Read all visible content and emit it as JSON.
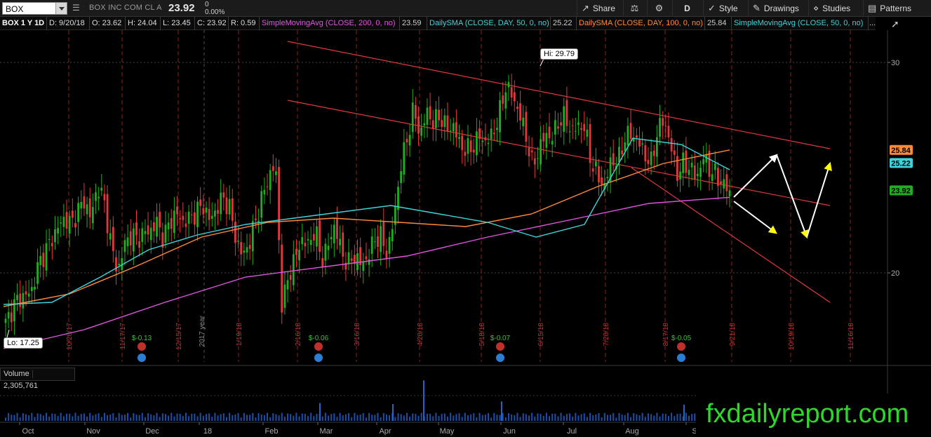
{
  "toolbar": {
    "symbol": "BOX",
    "company": "BOX INC COM CL A",
    "last": "23.92",
    "change": "0",
    "change_pct": "0.00%",
    "share": "Share",
    "aggregation": "D",
    "style": "Style",
    "drawings": "Drawings",
    "studies": "Studies",
    "patterns": "Patterns"
  },
  "infobar": {
    "title": "BOX 1 Y 1D",
    "date": "D: 9/20/18",
    "open": "O: 23.62",
    "high": "H: 24.04",
    "low": "L: 23.45",
    "close": "C: 23.92",
    "range": "R: 0.59",
    "sma200_label": "SimpleMovingAvg (CLOSE, 200, 0, no)",
    "sma200_val": "23.59",
    "sma50_label": "DailySMA (CLOSE, DAY, 50, 0, no)",
    "sma50_val": "25.22",
    "sma100_label": "DailySMA (CLOSE, DAY, 100, 0, no)",
    "sma100_val": "25.84",
    "sma50b_label": "SimpleMovingAvg (CLOSE, 50, 0, no)",
    "ellipsis": "..."
  },
  "volume": {
    "label": "Volume",
    "value": "2,305,761"
  },
  "watermark": "fxdailyreport.com",
  "colors": {
    "up": "#1fae1f",
    "down": "#e0393d",
    "sma50": "#3fd4dc",
    "sma100": "#ff8a3a",
    "sma200": "#e055e0",
    "channel": "#e0393d",
    "arrows": "#ffffff"
  },
  "chart_data": {
    "type": "candlestick",
    "ylim": [
      15.5,
      32.6
    ],
    "y_ticks": [
      20,
      30
    ],
    "y_tick_labels": [
      "20",
      "30"
    ],
    "months": [
      "Oct",
      "Nov",
      "Dec",
      "18",
      "Feb",
      "Mar",
      "Apr",
      "May",
      "Jun",
      "Jul",
      "Aug",
      "S"
    ],
    "expiration_dates": [
      "10/20/17",
      "11/17/17",
      "12/15/17",
      "1/19/18",
      "2/16/18",
      "3/16/18",
      "4/20/18",
      "5/18/18",
      "6/15/18",
      "7/20/18",
      "8/17/18",
      "9/21/18",
      "10/19/18",
      "11/16/18"
    ],
    "year_marker": "2017 year",
    "high": {
      "label": "Hi: 29.79",
      "value": 29.79
    },
    "low": {
      "label": "Lo: 17.25",
      "value": 17.25
    },
    "dividends": [
      "$-0.13",
      "$-0.06",
      "$-0.07",
      "$-0.05"
    ],
    "price_tags": [
      {
        "label": "25.84",
        "value": 25.84,
        "color": "#ff8a3a"
      },
      {
        "label": "25.22",
        "value": 25.22,
        "color": "#3fd4dc"
      },
      {
        "label": "23.92",
        "value": 23.92,
        "color": "#1fae1f"
      }
    ],
    "close_waypoints": [
      17.6,
      18.3,
      18.8,
      18.9,
      19.2,
      20.4,
      21.0,
      21.6,
      22.2,
      22.6,
      22.3,
      23.0,
      23.4,
      22.6,
      24.2,
      23.3,
      21.4,
      20.0,
      21.3,
      21.8,
      21.6,
      21.9,
      22.0,
      22.4,
      21.6,
      22.5,
      22.8,
      22.4,
      22.6,
      22.9,
      23.2,
      22.5,
      23.0,
      23.6,
      23.1,
      21.6,
      20.8,
      21.4,
      22.5,
      23.6,
      24.6,
      25.2,
      18.3,
      19.9,
      20.7,
      21.6,
      21.3,
      22.1,
      20.6,
      21.3,
      22.3,
      21.0,
      20.4,
      20.8,
      20.4,
      20.7,
      21.6,
      21.7,
      20.9,
      22.6,
      25.0,
      26.4,
      27.8,
      26.5,
      27.7,
      27.1,
      27.5,
      26.8,
      27.0,
      26.1,
      25.8,
      26.0,
      26.5,
      26.2,
      26.6,
      27.5,
      28.9,
      28.4,
      27.6,
      26.6,
      25.1,
      25.8,
      26.6,
      26.4,
      27.2,
      27.4,
      26.7,
      27.0,
      26.9,
      25.2,
      24.6,
      24.1,
      25.4,
      25.2,
      26.4,
      26.6,
      26.3,
      25.7,
      25.1,
      26.7,
      27.3,
      26.1,
      24.7,
      25.2,
      25.0,
      24.5,
      25.5,
      24.9,
      24.6,
      24.2,
      23.92
    ],
    "volume_range": [
      0,
      10000000
    ],
    "volume_spikes": [
      {
        "month": "Mar",
        "value": 3300000
      },
      {
        "month": "Apr",
        "value": 3100000
      },
      {
        "month": "May",
        "value": 7500000
      },
      {
        "month": "Jun",
        "value": 3600000
      },
      {
        "month": "Sep",
        "value": 3000000
      }
    ],
    "channel": {
      "upper": [
        [
          28.2,
          31.0
        ],
        [
          23.2,
          25.9
        ]
      ],
      "lower": [
        [
          25.0,
          23.0
        ],
        [
          20.8,
          18.6
        ]
      ],
      "color": "#e0393d"
    },
    "projection_arrows": [
      {
        "from": 23.6,
        "to": 25.6,
        "color": "#ffffff"
      },
      {
        "from": 23.4,
        "to": 21.9,
        "color": "#ffff00"
      },
      {
        "from": 25.6,
        "to": 21.7,
        "color": "#ffff00"
      },
      {
        "from": 21.7,
        "to": 25.2,
        "color": "#ffff00"
      }
    ],
    "series": [
      {
        "name": "SimpleMovingAvg (CLOSE, 50, 0, no)",
        "color": "#3fd4dc",
        "values": [
          18.5,
          18.6,
          19.8,
          21.1,
          21.8,
          22.3,
          22.6,
          22.9,
          23.2,
          22.8,
          22.4,
          21.7,
          22.3,
          26.4,
          26.1,
          24.9
        ]
      },
      {
        "name": "DailySMA (CLOSE, DAY, 100, 0, no)",
        "color": "#ff8a3a",
        "values": [
          18.4,
          19.0,
          20.3,
          21.7,
          22.4,
          22.6,
          22.4,
          22.2,
          22.8,
          24.1,
          25.2,
          25.84
        ]
      },
      {
        "name": "SimpleMovingAvg (CLOSE, 200, 0, no)",
        "color": "#e055e0",
        "values": [
          16.4,
          17.3,
          18.6,
          19.8,
          20.3,
          20.8,
          21.7,
          22.5,
          23.3,
          23.59
        ]
      }
    ]
  }
}
